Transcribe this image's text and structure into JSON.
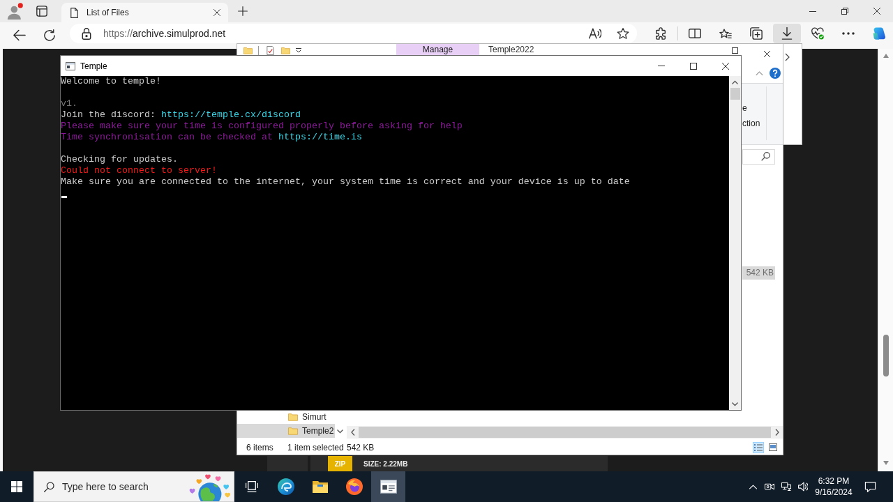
{
  "browser": {
    "tab": {
      "title": "List of Files",
      "selected": true
    },
    "address_bar": {
      "scheme": "https://",
      "host": "archive.simulprod.net"
    },
    "toolbar_buttons": [
      {
        "kind": "extensions",
        "selected": false
      },
      {
        "kind": "split",
        "selected": false
      },
      {
        "kind": "favorites",
        "selected": false
      },
      {
        "kind": "collections",
        "selected": false
      },
      {
        "kind": "downloads",
        "selected": true
      },
      {
        "kind": "essentials",
        "selected": false
      },
      {
        "kind": "more",
        "selected": false
      },
      {
        "kind": "copilot",
        "selected": false
      }
    ]
  },
  "page": {
    "file_card": {
      "type_badge": "ZIP",
      "size": "SIZE: 2.22MB"
    }
  },
  "explorer": {
    "title": "Temple2022",
    "context_tab": "Manage",
    "ribbon_labels": [
      "e",
      "ction"
    ],
    "nav_items": [
      {
        "label": "Simurt",
        "selected": false
      },
      {
        "label": "Temple2",
        "selected": true
      }
    ],
    "file_row": {
      "size": "542 KB",
      "selected": true
    },
    "status_bar": {
      "item_count": "6 items",
      "selection": "1 item selected",
      "selection_size": "542 KB"
    }
  },
  "console": {
    "title": "Temple",
    "blocks": [
      {
        "lines": [
          {
            "segments": [
              {
                "kind": "text",
                "text": "Welcome to temple!"
              }
            ]
          }
        ]
      },
      {
        "lines": [
          {
            "segments": [
              {
                "kind": "dim",
                "text": "v1."
              }
            ]
          },
          {
            "segments": [
              {
                "kind": "text",
                "text": "Join the discord: "
              },
              {
                "kind": "link",
                "text": "https://temple.cx/discord"
              }
            ]
          },
          {
            "segments": [
              {
                "kind": "notice",
                "text": "Please make sure your time is configured properly before asking for help"
              }
            ]
          },
          {
            "segments": [
              {
                "kind": "notice",
                "text": "Time synchronisation can be checked at "
              },
              {
                "kind": "link",
                "text": "https://time.is"
              }
            ]
          }
        ]
      },
      {
        "lines": [
          {
            "segments": [
              {
                "kind": "text",
                "text": "Checking for updates."
              }
            ]
          },
          {
            "segments": [
              {
                "kind": "error",
                "text": "Could not connect to server!"
              }
            ]
          },
          {
            "segments": [
              {
                "kind": "text",
                "text": "Make sure you are connected to the internet, your system time is correct and your device is up to date"
              }
            ]
          }
        ]
      }
    ]
  },
  "taskbar": {
    "search": {
      "placeholder": "Type here to search"
    },
    "apps": [
      {
        "kind": "taskview",
        "selected": false
      },
      {
        "kind": "edge",
        "selected": false
      },
      {
        "kind": "folder",
        "selected": false
      },
      {
        "kind": "firefox",
        "selected": false
      },
      {
        "kind": "console",
        "selected": true
      }
    ],
    "clock": {
      "time": "6:32 PM",
      "date": "9/16/2024"
    }
  }
}
